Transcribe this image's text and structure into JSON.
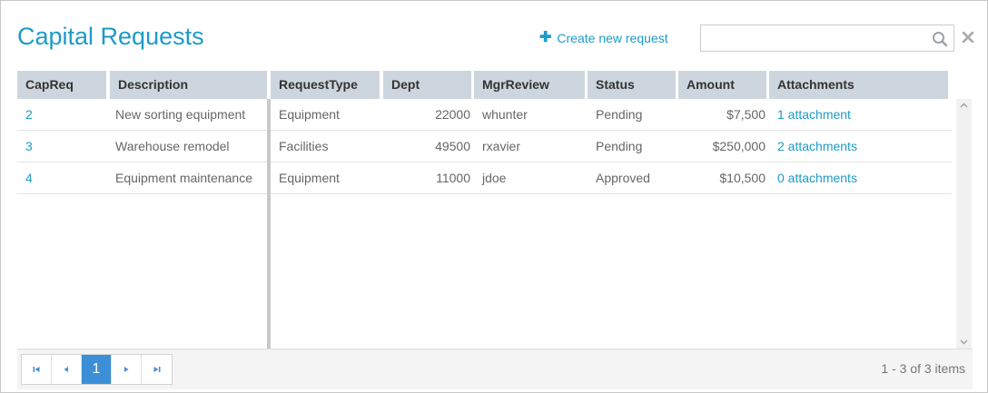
{
  "header": {
    "title": "Capital Requests",
    "create_label": "Create new request"
  },
  "search": {
    "value": "",
    "placeholder": ""
  },
  "grid": {
    "columns": [
      "CapReq",
      "Description",
      "RequestType",
      "Dept",
      "MgrReview",
      "Status",
      "Amount",
      "Attachments"
    ],
    "rows": [
      {
        "capreq": "2",
        "description": "New sorting equipment",
        "request_type": "Equipment",
        "dept": "22000",
        "mgr_review": "whunter",
        "status": "Pending",
        "amount": "$7,500",
        "attachments": "1 attachment"
      },
      {
        "capreq": "3",
        "description": "Warehouse remodel",
        "request_type": "Facilities",
        "dept": "49500",
        "mgr_review": "rxavier",
        "status": "Pending",
        "amount": "$250,000",
        "attachments": "2 attachments"
      },
      {
        "capreq": "4",
        "description": "Equipment maintenance",
        "request_type": "Equipment",
        "dept": "11000",
        "mgr_review": "jdoe",
        "status": "Approved",
        "amount": "$10,500",
        "attachments": "0 attachments"
      }
    ]
  },
  "pager": {
    "current_page": "1",
    "info": "1 - 3 of 3 items"
  },
  "icons": {
    "plus": "plus-icon",
    "search": "search-icon",
    "close": "close-icon",
    "first": "first-page-icon",
    "prev": "prev-page-icon",
    "next": "next-page-icon",
    "last": "last-page-icon"
  },
  "colors": {
    "accent": "#1d9bc9",
    "header_bg": "#cdd6de",
    "active_page": "#3c8fd6"
  }
}
